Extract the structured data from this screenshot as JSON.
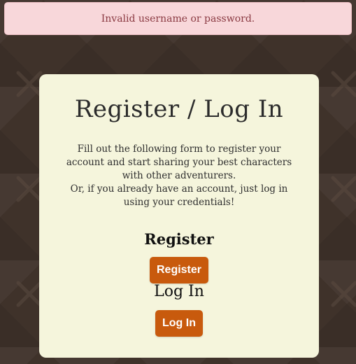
{
  "alert": {
    "message": "Invalid username or password."
  },
  "card": {
    "title": "Register / Log In",
    "description_line1": "Fill out the following form to register your account and start sharing your best characters with other adventurers.",
    "description_line2": "Or, if you already have an account, just log in using your credentials!",
    "register": {
      "heading": "Register",
      "button_label": "Register"
    },
    "login": {
      "heading": "Log In",
      "button_label": "Log In"
    }
  },
  "background": {
    "icon": "crossed-swords-icon"
  },
  "colors": {
    "background": "#3f322a",
    "card": "#f5f5dc",
    "alert_bg": "#f8d7da",
    "alert_text": "#8a3a42",
    "button": "#c85a0d"
  }
}
